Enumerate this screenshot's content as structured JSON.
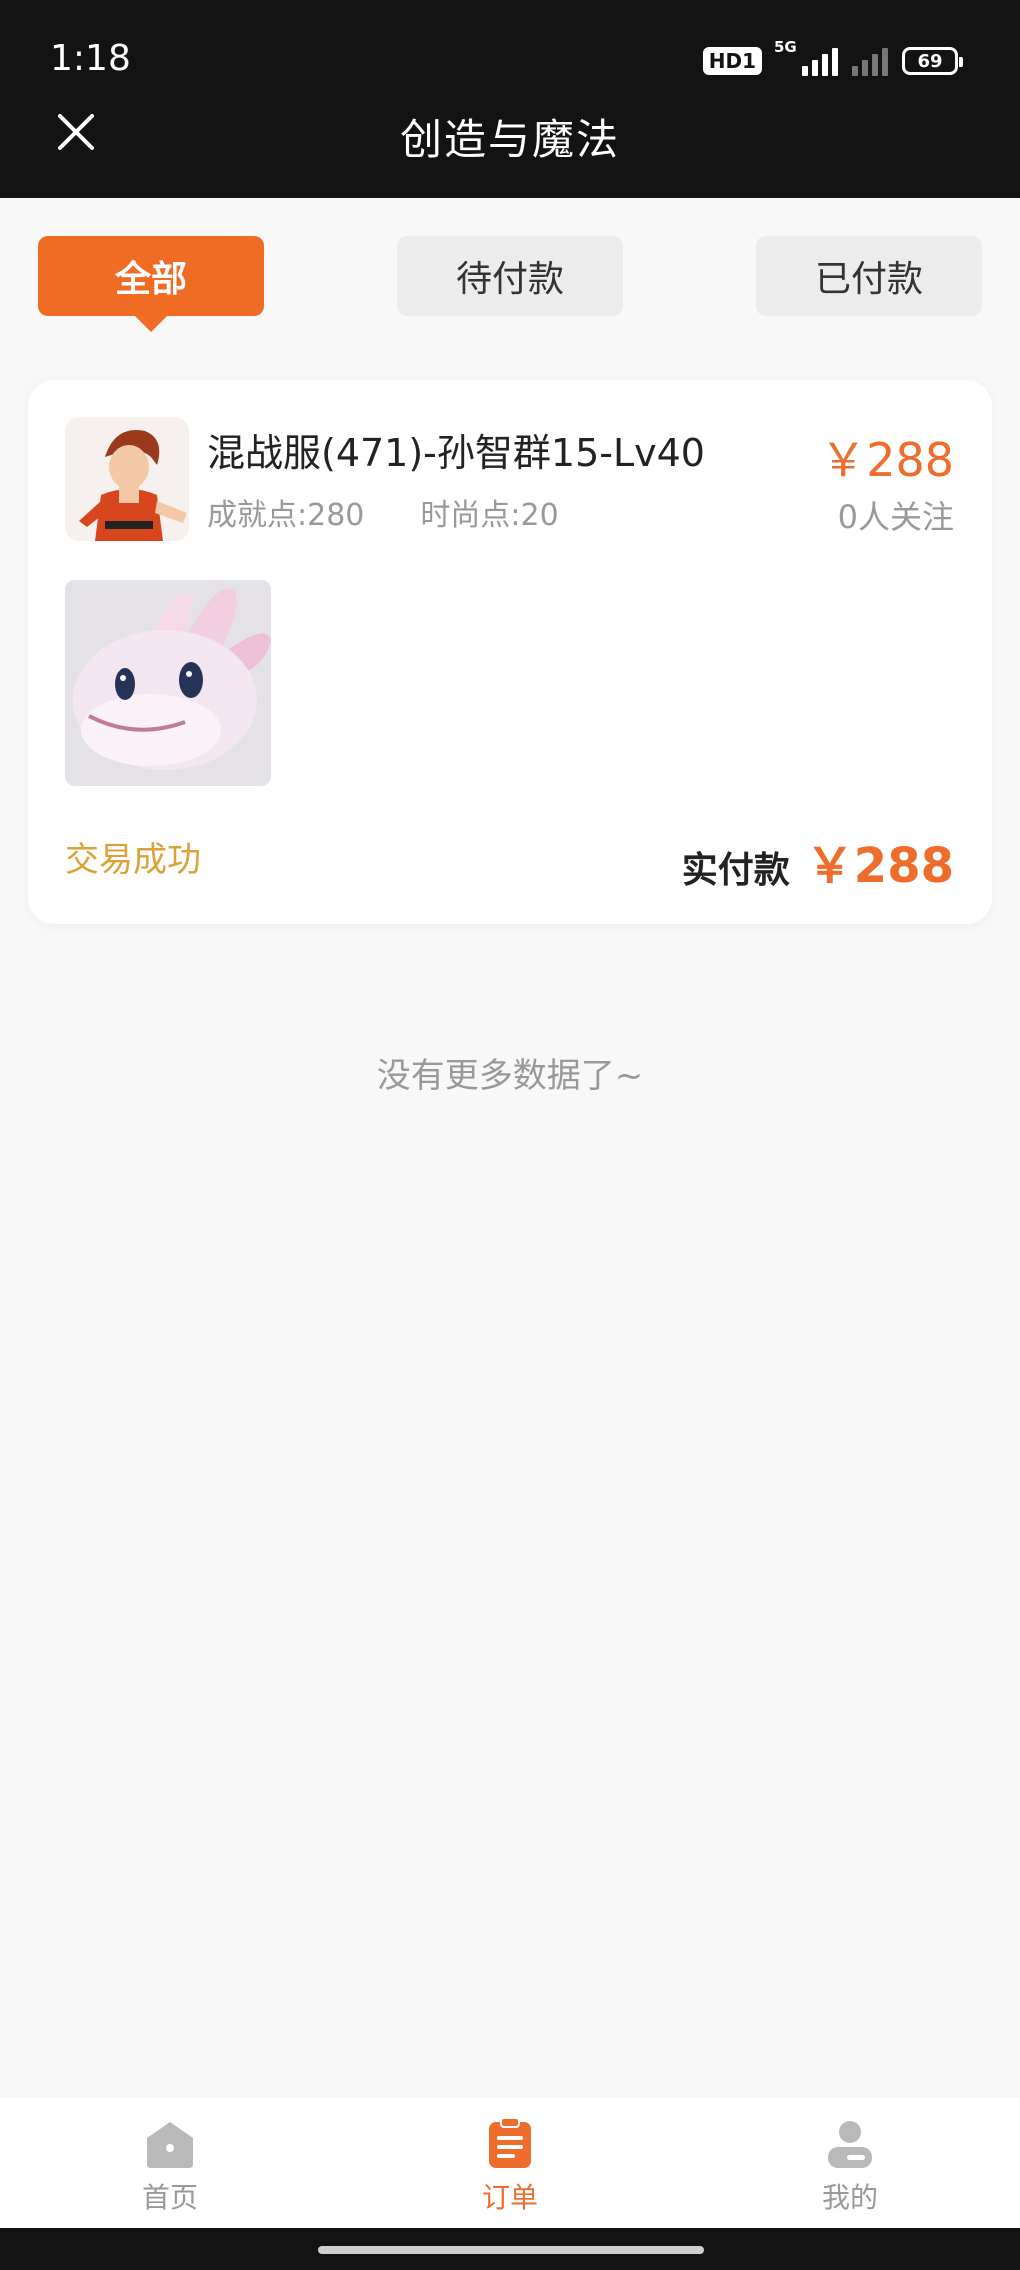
{
  "status_bar": {
    "time": "1:18",
    "hd_badge": "HD1",
    "network": "5G",
    "battery": "69"
  },
  "header": {
    "title": "创造与魔法",
    "close_icon": "close-icon"
  },
  "tabs": [
    {
      "label": "全部",
      "active": true
    },
    {
      "label": "待付款",
      "active": false
    },
    {
      "label": "已付款",
      "active": false
    }
  ],
  "order": {
    "title": "混战服(471)-孙智群15-Lv40",
    "achievement": "成就点:280",
    "fashion": "时尚点:20",
    "price": "￥288",
    "followers": "0人关注",
    "status": "交易成功",
    "paid_label": "实付款",
    "paid_amount": "￥288"
  },
  "no_more_text": "没有更多数据了~",
  "bottom_nav": [
    {
      "label": "首页",
      "icon": "home-icon",
      "active": false
    },
    {
      "label": "订单",
      "icon": "order-icon",
      "active": true
    },
    {
      "label": "我的",
      "icon": "profile-icon",
      "active": false
    }
  ],
  "colors": {
    "accent": "#f06b24",
    "price": "#ee6d2c",
    "status": "#dca23a",
    "topbar": "#131313"
  }
}
